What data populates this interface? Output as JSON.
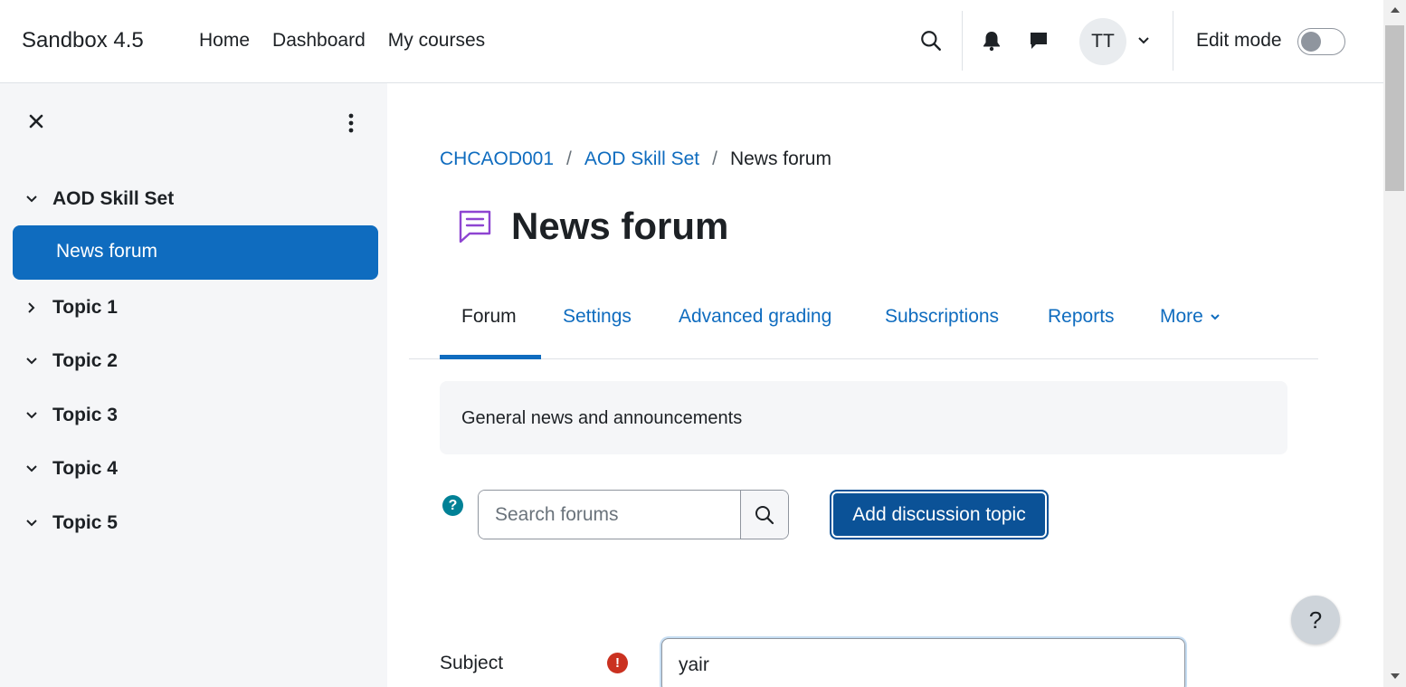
{
  "navbar": {
    "brand": "Sandbox 4.5",
    "links": [
      "Home",
      "Dashboard",
      "My courses"
    ],
    "avatar_initials": "TT",
    "edit_mode_label": "Edit mode",
    "edit_mode_on": false
  },
  "drawer": {
    "sections": [
      {
        "label": "AOD Skill Set",
        "expanded": true
      },
      {
        "label": "Topic 1",
        "expanded": false
      },
      {
        "label": "Topic 2",
        "expanded": true
      },
      {
        "label": "Topic 3",
        "expanded": true
      },
      {
        "label": "Topic 4",
        "expanded": true
      },
      {
        "label": "Topic 5",
        "expanded": true
      }
    ],
    "active_item": "News forum"
  },
  "breadcrumb": {
    "items": [
      "CHCAOD001",
      "AOD Skill Set"
    ],
    "current": "News forum",
    "separator": "/"
  },
  "page": {
    "title": "News forum",
    "intro": "General news and announcements"
  },
  "tabs": [
    "Forum",
    "Settings",
    "Advanced grading",
    "Subscriptions",
    "Reports",
    "More"
  ],
  "search": {
    "placeholder": "Search forums"
  },
  "actions": {
    "add_discussion": "Add discussion topic"
  },
  "form": {
    "subject_label": "Subject",
    "subject_value": "yair"
  },
  "colors": {
    "primary": "#0f6cbf",
    "primary_dark": "#0b5297",
    "drawer_bg": "#f5f6f8",
    "help_teal": "#008196",
    "required_red": "#ca3120",
    "forum_icon_purple": "#8e44d1"
  },
  "help_button": "?"
}
